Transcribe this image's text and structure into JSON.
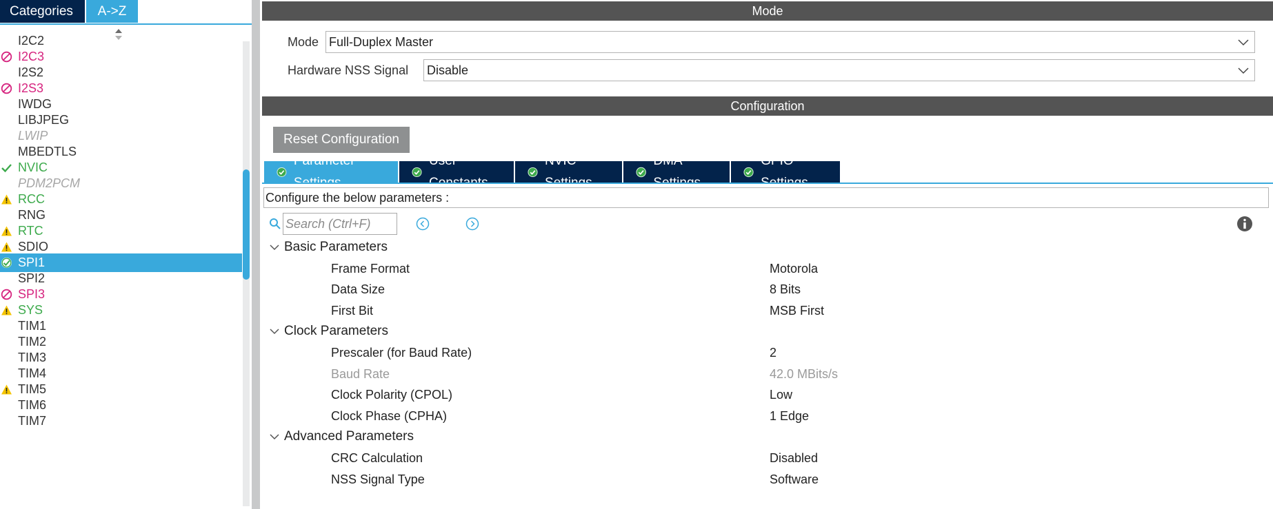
{
  "left_panel": {
    "tabs": [
      {
        "label": "Categories",
        "active": false
      },
      {
        "label": "A->Z",
        "active": true
      }
    ],
    "items": [
      {
        "label": "I2C2",
        "state": "normal",
        "icon": null
      },
      {
        "label": "I2C3",
        "state": "blocked",
        "icon": "blocked-icon"
      },
      {
        "label": "I2S2",
        "state": "normal",
        "icon": null
      },
      {
        "label": "I2S3",
        "state": "blocked",
        "icon": "blocked-icon"
      },
      {
        "label": "IWDG",
        "state": "normal",
        "icon": null
      },
      {
        "label": "LIBJPEG",
        "state": "normal",
        "icon": null
      },
      {
        "label": "LWIP",
        "state": "disabled",
        "icon": null
      },
      {
        "label": "MBEDTLS",
        "state": "normal",
        "icon": null
      },
      {
        "label": "NVIC",
        "state": "ok",
        "icon": "checkmark-icon"
      },
      {
        "label": "PDM2PCM",
        "state": "disabled",
        "icon": null
      },
      {
        "label": "RCC",
        "state": "ok",
        "icon": "warning-icon"
      },
      {
        "label": "RNG",
        "state": "normal",
        "icon": null
      },
      {
        "label": "RTC",
        "state": "ok",
        "icon": "warning-icon"
      },
      {
        "label": "SDIO",
        "state": "normal",
        "icon": "warning-icon"
      },
      {
        "label": "SPI1",
        "state": "selected",
        "icon": "check-circle-icon"
      },
      {
        "label": "SPI2",
        "state": "normal",
        "icon": null
      },
      {
        "label": "SPI3",
        "state": "blocked",
        "icon": "blocked-icon"
      },
      {
        "label": "SYS",
        "state": "ok",
        "icon": "warning-icon"
      },
      {
        "label": "TIM1",
        "state": "normal",
        "icon": null
      },
      {
        "label": "TIM2",
        "state": "normal",
        "icon": null
      },
      {
        "label": "TIM3",
        "state": "normal",
        "icon": null
      },
      {
        "label": "TIM4",
        "state": "normal",
        "icon": null
      },
      {
        "label": "TIM5",
        "state": "normal",
        "icon": "warning-icon"
      },
      {
        "label": "TIM6",
        "state": "normal",
        "icon": null
      },
      {
        "label": "TIM7",
        "state": "normal",
        "icon": null
      }
    ]
  },
  "mode_section": {
    "title": "Mode",
    "mode_label": "Mode",
    "mode_value": "Full-Duplex Master",
    "nss_label": "Hardware NSS Signal",
    "nss_value": "Disable"
  },
  "config_section": {
    "title": "Configuration",
    "reset_button": "Reset Configuration",
    "tabs": [
      {
        "label": "Parameter Settings",
        "active": true
      },
      {
        "label": "User Constants",
        "active": false
      },
      {
        "label": "NVIC Settings",
        "active": false
      },
      {
        "label": "DMA Settings",
        "active": false
      },
      {
        "label": "GPIO Settings",
        "active": false
      }
    ],
    "describe": "Configure the below parameters :",
    "search_placeholder": "Search (Ctrl+F)",
    "groups": [
      {
        "title": "Basic Parameters",
        "params": [
          {
            "name": "Frame Format",
            "value": "Motorola",
            "dim": false
          },
          {
            "name": "Data Size",
            "value": "8 Bits",
            "dim": false
          },
          {
            "name": "First Bit",
            "value": "MSB First",
            "dim": false
          }
        ]
      },
      {
        "title": "Clock Parameters",
        "params": [
          {
            "name": "Prescaler (for Baud Rate)",
            "value": "2",
            "dim": false
          },
          {
            "name": "Baud Rate",
            "value": "42.0 MBits/s",
            "dim": true
          },
          {
            "name": "Clock Polarity (CPOL)",
            "value": "Low",
            "dim": false
          },
          {
            "name": "Clock Phase (CPHA)",
            "value": "1 Edge",
            "dim": false
          }
        ]
      },
      {
        "title": "Advanced Parameters",
        "params": [
          {
            "name": "CRC Calculation",
            "value": "Disabled",
            "dim": false
          },
          {
            "name": "NSS Signal Type",
            "value": "Software",
            "dim": false
          }
        ]
      }
    ]
  },
  "colors": {
    "navy": "#03234b",
    "accent_blue": "#39a9dc",
    "header_gray": "#545454",
    "blocked_pink": "#d6247f",
    "ok_green": "#3daa4c",
    "warning_yellow": "#f5c400"
  }
}
